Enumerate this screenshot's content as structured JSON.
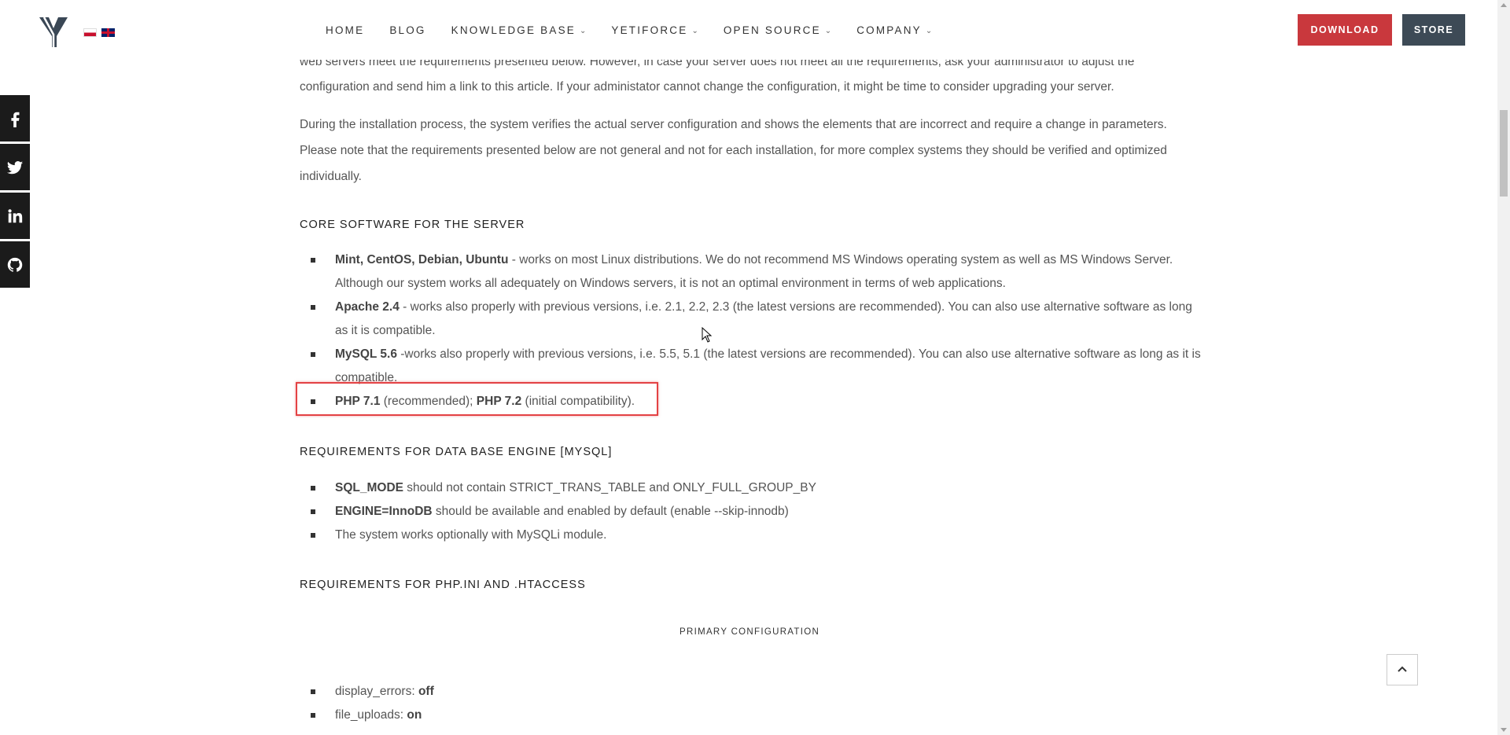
{
  "header": {
    "nav": [
      {
        "label": "HOME",
        "dropdown": false
      },
      {
        "label": "BLOG",
        "dropdown": false
      },
      {
        "label": "KNOWLEDGE BASE",
        "dropdown": true
      },
      {
        "label": "YETIFORCE",
        "dropdown": true
      },
      {
        "label": "OPEN SOURCE",
        "dropdown": true
      },
      {
        "label": "COMPANY",
        "dropdown": true
      }
    ],
    "download_label": "DOWNLOAD",
    "store_label": "STORE",
    "chevron": "⌄"
  },
  "social": [
    "facebook-icon",
    "twitter-icon",
    "linkedin-icon",
    "github-icon"
  ],
  "content": {
    "intro_clipped": "web servers meet the requirements presented below. However, in case your server does not meet all the requirements, ask your administrator to adjust the",
    "intro_line2": "configuration and send him a link to this article. If your administator cannot change the configuration, it might be time to consider upgrading your server.",
    "install_para": "During the installation process, the system verifies the actual server configuration and shows the elements that are incorrect and require a change in parameters. Please note that the requirements presented below are not general and not for each installation, for more complex systems they should be verified and optimized individually.",
    "core_heading": "CORE SOFTWARE FOR THE SERVER",
    "core_items": [
      {
        "bold": "Mint, CentOS, Debian, Ubuntu",
        "text": " - works on most Linux distributions. We do not recommend MS Windows operating system as well as MS Windows Server. Although our system works all adequately on Windows servers, it is not an optimal environment in terms of web applications."
      },
      {
        "bold": "Apache 2.4",
        "text": " - works also properly with previous versions, i.e. 2.1, 2.2, 2.3 (the latest versions are recommended). You can also use alternative software as long as it is compatible."
      },
      {
        "bold": "MySQL 5.6",
        "text": " -works also properly with previous versions, i.e. 5.5, 5.1 (the latest versions are recommended). You can also use alternative software as long as it is compatible."
      }
    ],
    "php_item": {
      "bold1": "PHP 7.1",
      "text1": " (recommended); ",
      "bold2": "PHP 7.2",
      "text2": " (initial compatibility)."
    },
    "db_heading": "REQUIREMENTS FOR DATA BASE ENGINE [MYSQL]",
    "db_items": [
      {
        "bold": "SQL_MODE",
        "text": " should not contain STRICT_TRANS_TABLE and ONLY_FULL_GROUP_BY"
      },
      {
        "bold": "ENGINE=InnoDB",
        "text": " should be available and enabled by default (enable --skip-innodb)"
      },
      {
        "bold": "",
        "text": "The system works optionally with MySQLi module."
      }
    ],
    "php_heading": "REQUIREMENTS FOR PHP.INI AND .HTACCESS",
    "primary_config": "PRIMARY CONFIGURATION",
    "config_items": [
      {
        "key": "display_errors:",
        "value": " off"
      },
      {
        "key": "file_uploads:",
        "value": " on"
      }
    ]
  },
  "colors": {
    "download_bg": "#c9383d",
    "store_bg": "#3d4a56",
    "highlight": "#e34244",
    "social_bg": "#1b1b1b"
  }
}
